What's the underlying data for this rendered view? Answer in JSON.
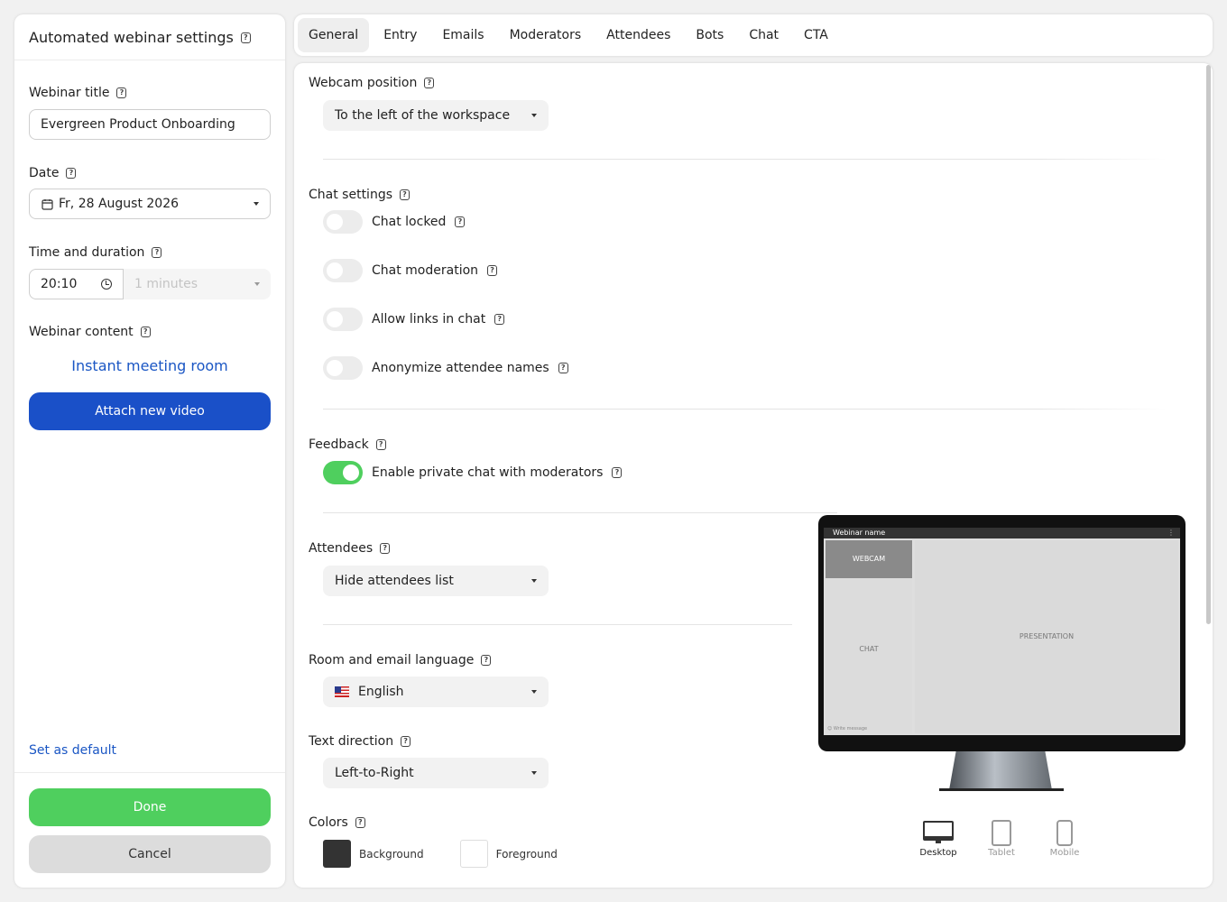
{
  "sidebar": {
    "title": "Automated webinar settings",
    "webinar_title_label": "Webinar title",
    "webinar_title_value": "Evergreen Product Onboarding",
    "date_label": "Date",
    "date_value": "Fr, 28 August 2026",
    "time_label": "Time and duration",
    "time_value": "20:10",
    "duration_placeholder": "1 minutes",
    "content_label": "Webinar content",
    "content_link": "Instant meeting room",
    "attach_button": "Attach new video",
    "set_default": "Set as default",
    "done_button": "Done",
    "cancel_button": "Cancel"
  },
  "tabs": [
    {
      "label": "General",
      "active": true
    },
    {
      "label": "Entry"
    },
    {
      "label": "Emails"
    },
    {
      "label": "Moderators"
    },
    {
      "label": "Attendees"
    },
    {
      "label": "Bots"
    },
    {
      "label": "Chat"
    },
    {
      "label": "CTA"
    }
  ],
  "main": {
    "webcam_label": "Webcam position",
    "webcam_value": "To the left of the workspace",
    "chat_label": "Chat settings",
    "chat_toggles": [
      {
        "label": "Chat locked",
        "on": false
      },
      {
        "label": "Chat moderation",
        "on": false
      },
      {
        "label": "Allow links in chat",
        "on": false
      },
      {
        "label": "Anonymize attendee names",
        "on": false
      }
    ],
    "feedback_label": "Feedback",
    "feedback_toggle": {
      "label": "Enable private chat with moderators",
      "on": true
    },
    "attendees_label": "Attendees",
    "attendees_value": "Hide attendees list",
    "language_label": "Room and email language",
    "language_value": "English",
    "direction_label": "Text direction",
    "direction_value": "Left-to-Right",
    "colors_label": "Colors",
    "background_label": "Background",
    "foreground_label": "Foreground",
    "background_color": "#333333",
    "foreground_color": "#ffffff"
  },
  "preview": {
    "webinar_name": "Webinar name",
    "webcam": "WEBCAM",
    "chat": "CHAT",
    "presentation": "PRESENTATION",
    "write_message": "Write message",
    "devices": [
      {
        "label": "Desktop",
        "icon": "desktop-icon",
        "active": true
      },
      {
        "label": "Tablet",
        "icon": "tablet-icon"
      },
      {
        "label": "Mobile",
        "icon": "mobile-icon"
      }
    ]
  },
  "colors": {
    "accent_blue": "#1a50c8",
    "link_blue": "#1a56c4",
    "success_green": "#4fcf5e"
  }
}
